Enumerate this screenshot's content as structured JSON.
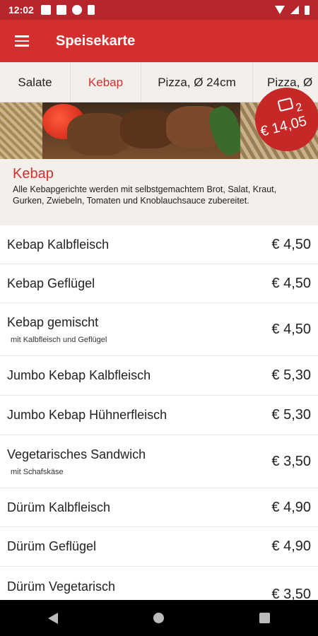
{
  "status": {
    "time": "12:02"
  },
  "app": {
    "title": "Speisekarte"
  },
  "tabs": [
    {
      "label": "Salate",
      "active": false
    },
    {
      "label": "Kebap",
      "active": true
    },
    {
      "label": "Pizza, Ø 24cm",
      "active": false
    },
    {
      "label": "Pizza, Ø",
      "active": false
    }
  ],
  "cart": {
    "count": "2",
    "total": "€ 14,05"
  },
  "category": {
    "title": "Kebap",
    "description": "Alle Kebapgerichte werden mit selbstgemachtem Brot, Salat, Kraut, Gurken, Zwiebeln, Tomaten und Knoblauchsauce zubereitet."
  },
  "items": [
    {
      "name": "Kebap Kalbfleisch",
      "sub": "",
      "price": "€ 4,50"
    },
    {
      "name": "Kebap Geflügel",
      "sub": "",
      "price": "€ 4,50"
    },
    {
      "name": "Kebap gemischt",
      "sub": "mit Kalbfleisch und Geflügel",
      "price": "€ 4,50"
    },
    {
      "name": "Jumbo Kebap Kalbfleisch",
      "sub": "",
      "price": "€ 5,30"
    },
    {
      "name": "Jumbo Kebap Hühnerfleisch",
      "sub": "",
      "price": "€ 5,30"
    },
    {
      "name": "Vegetarisches Sandwich",
      "sub": "mit Schafskäse",
      "price": "€ 3,50"
    },
    {
      "name": "Dürüm Kalbfleisch",
      "sub": "",
      "price": "€ 4,90"
    },
    {
      "name": "Dürüm Geflügel",
      "sub": "",
      "price": "€ 4,90"
    },
    {
      "name": "Dürüm Vegetarisch",
      "sub": "",
      "price": "€ 3,50"
    }
  ],
  "colors": {
    "primary": "#d32f2f",
    "statusbar": "#b7262a",
    "badge": "#c62828",
    "header_bg": "#f3f0ec"
  }
}
